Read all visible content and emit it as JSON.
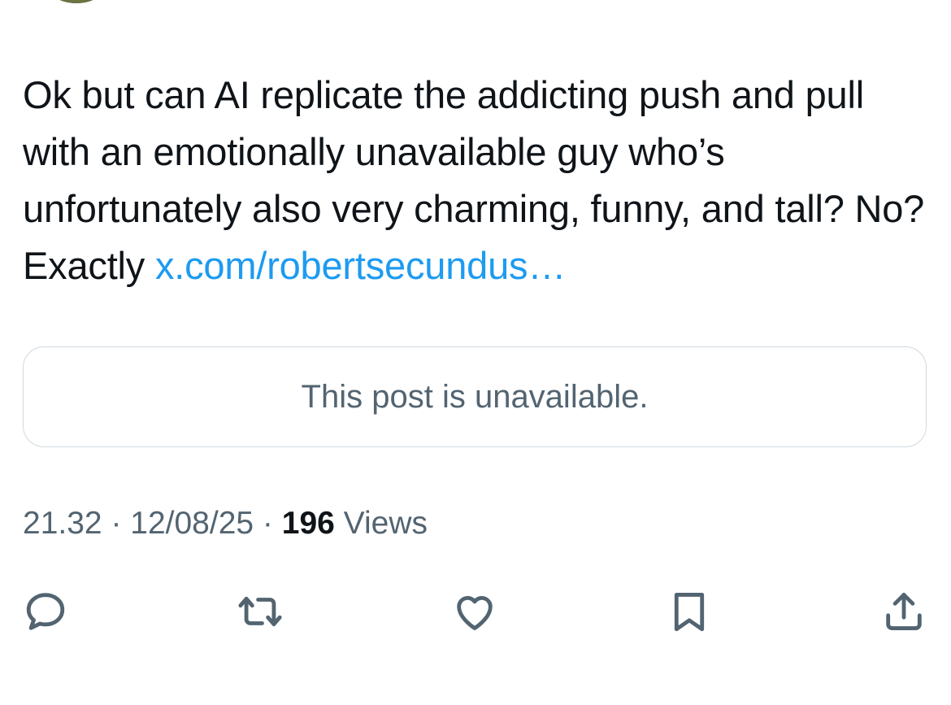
{
  "tweet": {
    "text": "Ok but can AI replicate the addicting push and pull with an emotionally unavailable guy who’s unfortunately also very charming, funny, and tall? No? Exactly ",
    "link_text": "x.com/robertsecundus…"
  },
  "quote": {
    "unavailable_text": "This post is unavailable."
  },
  "meta": {
    "time": "21.32",
    "separator": " · ",
    "date": "12/08/25",
    "views_count": "196",
    "views_label": " Views"
  },
  "colors": {
    "text": "#0f1419",
    "secondary": "#536471",
    "link": "#1d9bf0",
    "border": "#cfd9de"
  },
  "actions": {
    "reply_icon": "reply-icon",
    "repost_icon": "repost-icon",
    "like_icon": "like-icon",
    "bookmark_icon": "bookmark-icon",
    "share_icon": "share-icon"
  }
}
